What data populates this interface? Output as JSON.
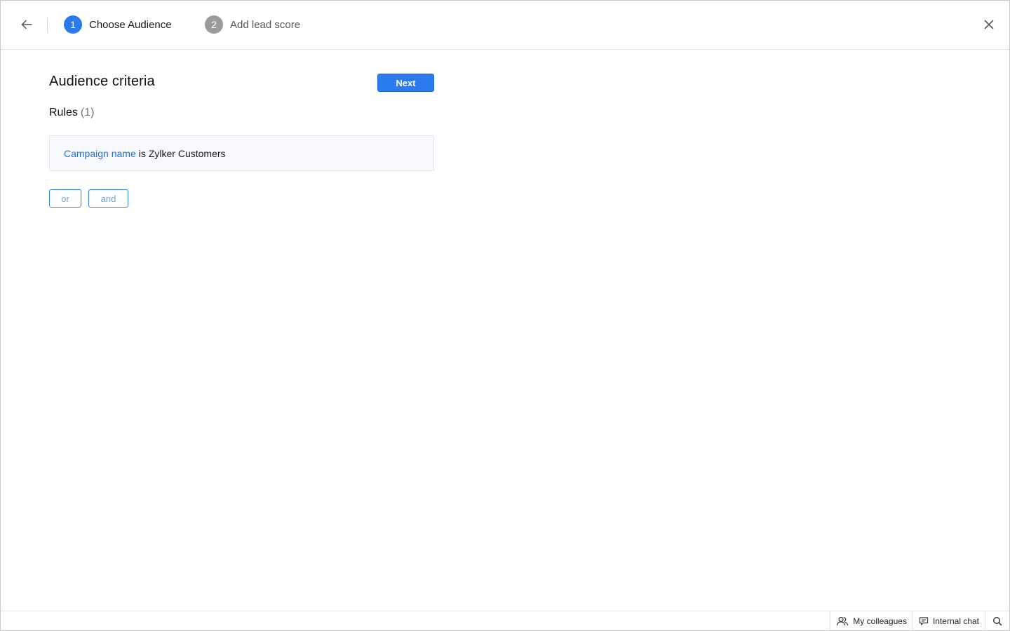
{
  "header": {
    "steps": [
      {
        "number": "1",
        "label": "Choose Audience",
        "active": true
      },
      {
        "number": "2",
        "label": "Add lead score",
        "active": false
      }
    ]
  },
  "main": {
    "title": "Audience criteria",
    "next_label": "Next",
    "rules_label": "Rules",
    "rules_count": "(1)",
    "rules": [
      {
        "field": "Campaign name",
        "operator": "is",
        "value": "Zylker Customers"
      }
    ],
    "logic_buttons": {
      "or": "or",
      "and": "and"
    }
  },
  "footer": {
    "colleagues_label": "My colleagues",
    "chat_label": "Internal chat"
  },
  "colors": {
    "accent": "#2b7bef",
    "link": "#1f73d3",
    "step_inactive": "#9b9b9b"
  },
  "icons": [
    "back-arrow-icon",
    "close-icon",
    "colleagues-icon",
    "chat-icon",
    "search-icon"
  ]
}
